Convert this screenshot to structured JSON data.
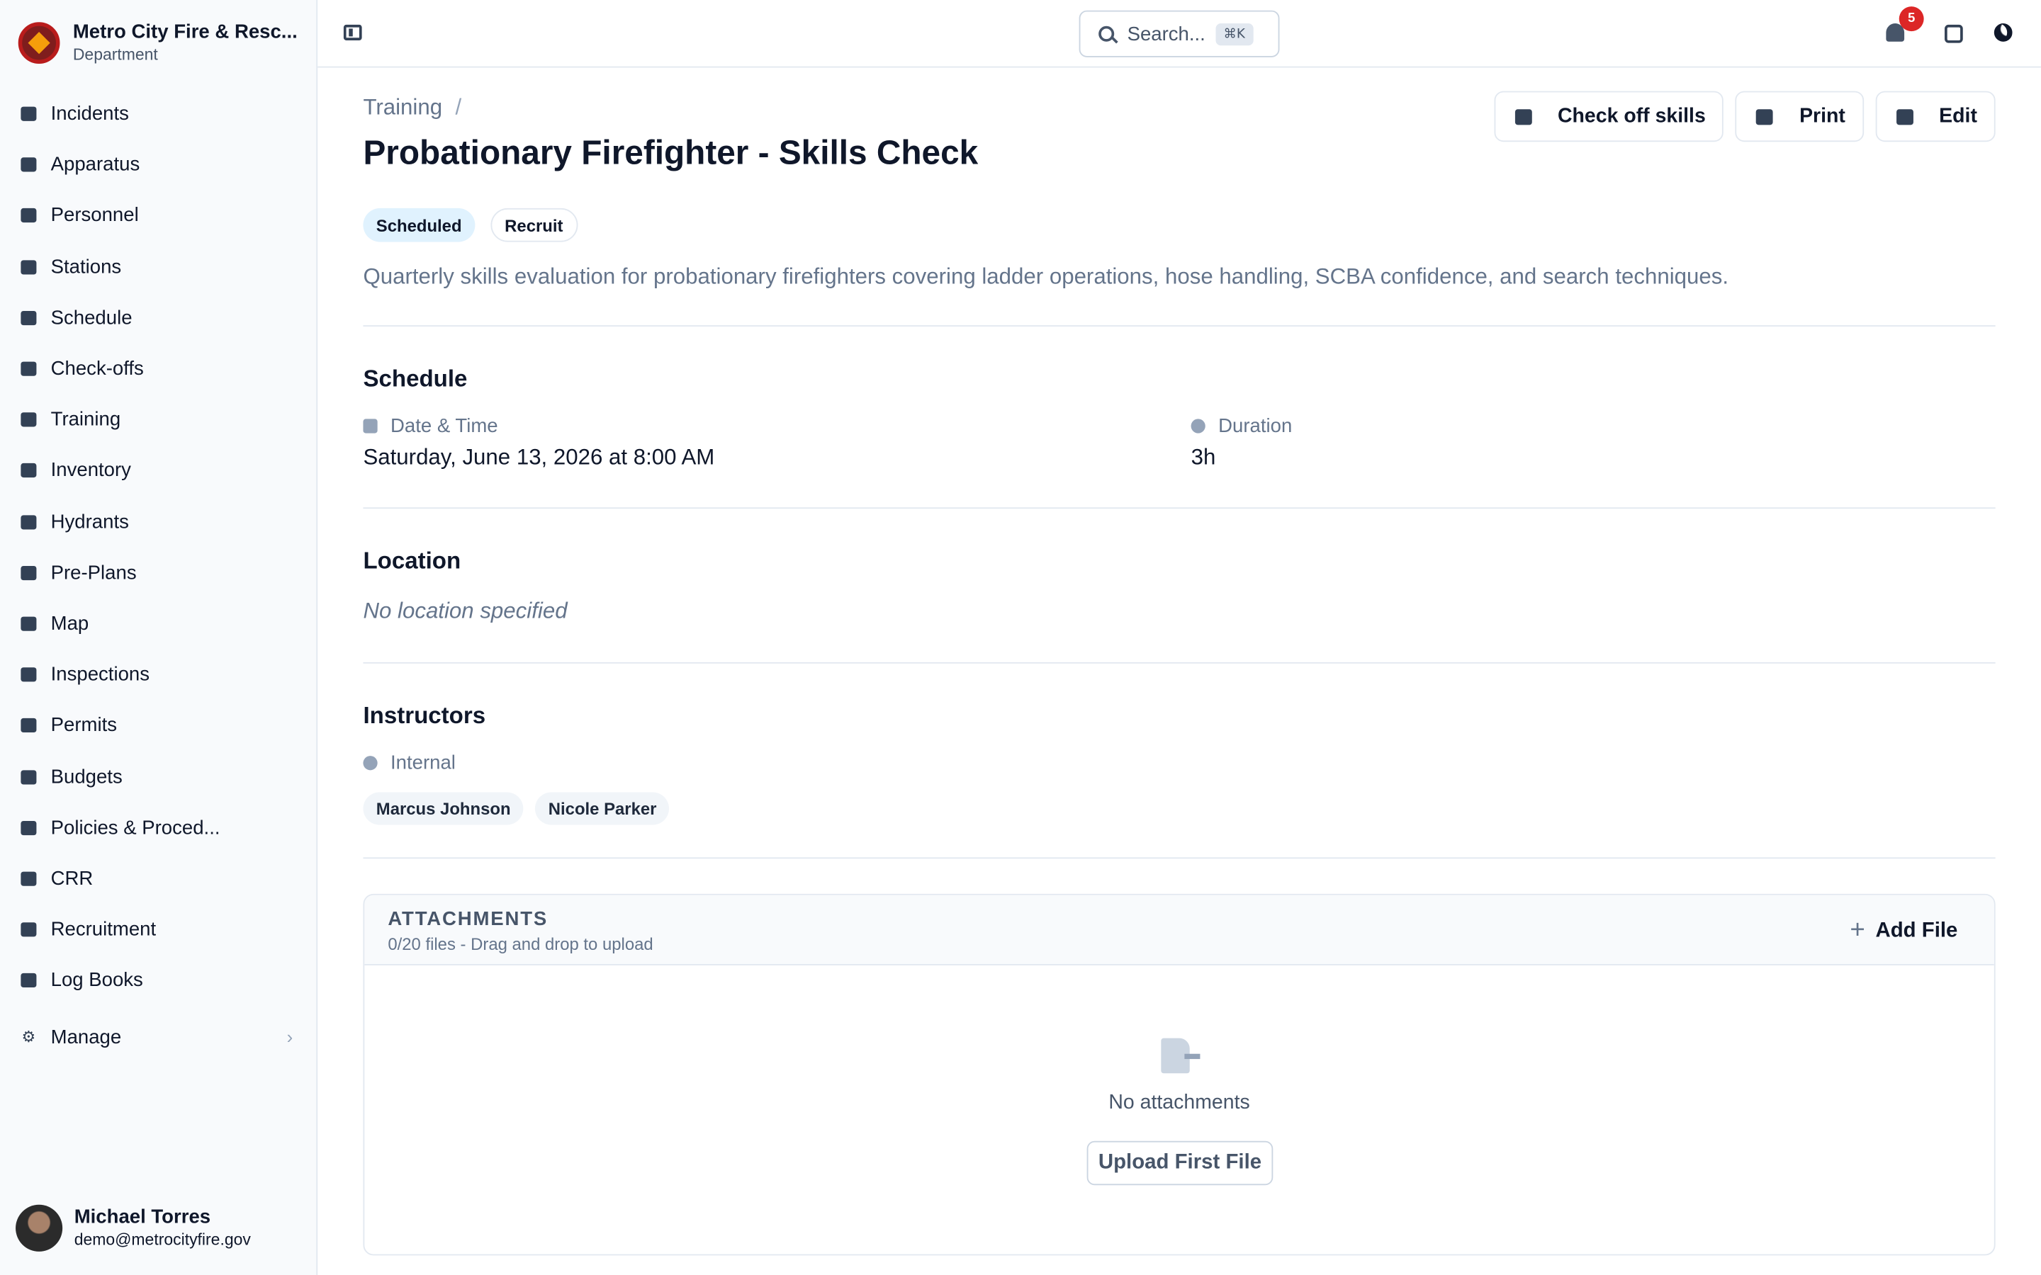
{
  "brand": {
    "name": "Metro City Fire & Resc...",
    "subtitle": "Department"
  },
  "sidebar": {
    "items": [
      {
        "label": "Incidents",
        "icon": "incidents-icon"
      },
      {
        "label": "Apparatus",
        "icon": "apparatus-icon"
      },
      {
        "label": "Personnel",
        "icon": "personnel-icon"
      },
      {
        "label": "Stations",
        "icon": "stations-icon"
      },
      {
        "label": "Schedule",
        "icon": "calendar-icon"
      },
      {
        "label": "Check-offs",
        "icon": "clipboard-icon"
      },
      {
        "label": "Training",
        "icon": "graduation-cap-icon"
      },
      {
        "label": "Inventory",
        "icon": "wrench-icon"
      },
      {
        "label": "Hydrants",
        "icon": "hydrant-icon"
      },
      {
        "label": "Pre-Plans",
        "icon": "building-icon"
      },
      {
        "label": "Map",
        "icon": "map-icon"
      },
      {
        "label": "Inspections",
        "icon": "inspections-icon"
      },
      {
        "label": "Permits",
        "icon": "permits-icon"
      },
      {
        "label": "Budgets",
        "icon": "piggy-bank-icon"
      },
      {
        "label": "Policies & Proced...",
        "icon": "book-icon"
      },
      {
        "label": "CRR",
        "icon": "megaphone-icon"
      },
      {
        "label": "Recruitment",
        "icon": "handshake-icon"
      },
      {
        "label": "Log Books",
        "icon": "books-icon"
      }
    ],
    "manage": {
      "label": "Manage",
      "icon": "gear-icon"
    }
  },
  "user": {
    "name": "Michael Torres",
    "email": "demo@metrocityfire.gov"
  },
  "topbar": {
    "search_placeholder": "Search...",
    "search_shortcut": "⌘K",
    "notification_count": "5"
  },
  "page": {
    "breadcrumb": "Training",
    "breadcrumb_sep": "/",
    "title": "Probationary Firefighter - Skills Check",
    "actions": {
      "check_off": "Check off skills",
      "print": "Print",
      "edit": "Edit"
    },
    "badges": {
      "status": "Scheduled",
      "type": "Recruit"
    },
    "description": "Quarterly skills evaluation for probationary firefighters covering ladder operations, hose handling, SCBA confidence, and search techniques."
  },
  "schedule": {
    "title": "Schedule",
    "date_label": "Date & Time",
    "date_value": "Saturday, June 13, 2026 at 8:00 AM",
    "duration_label": "Duration",
    "duration_value": "3h"
  },
  "location": {
    "title": "Location",
    "value": "No location specified"
  },
  "instructors": {
    "title": "Instructors",
    "type_label": "Internal",
    "names": [
      "Marcus Johnson",
      "Nicole Parker"
    ]
  },
  "attachments": {
    "title": "ATTACHMENTS",
    "subtitle": "0/20 files - Drag and drop to upload",
    "add_label": "Add File",
    "empty_text": "No attachments",
    "upload_label": "Upload First File"
  },
  "colors": {
    "accent": "#0f172a",
    "badge_bg": "#e0f2fe",
    "notification": "#dc2626"
  }
}
